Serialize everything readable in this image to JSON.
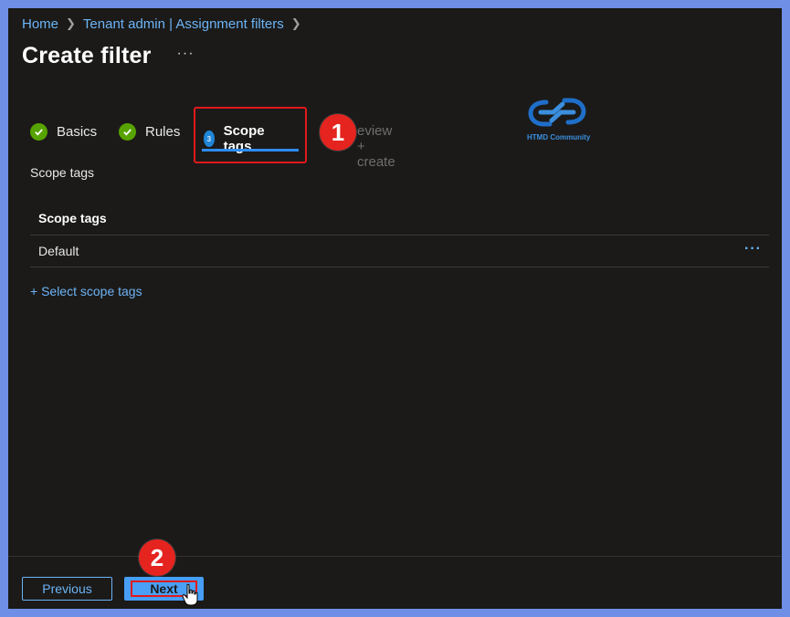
{
  "breadcrumb": {
    "items": [
      "Home",
      "Tenant admin | Assignment filters"
    ]
  },
  "page": {
    "title": "Create filter",
    "more_label": "···"
  },
  "steps": [
    {
      "label": "Basics",
      "state": "complete"
    },
    {
      "label": "Rules",
      "state": "complete"
    },
    {
      "label": "Scope tags",
      "state": "active",
      "number": "3"
    },
    {
      "label": "Review + create",
      "visible_label": "eview + create",
      "state": "upcoming"
    }
  ],
  "annotations": {
    "badge1": "1",
    "badge2": "2"
  },
  "logo": {
    "text": "HTMD Community",
    "icon": "chain-link-logo"
  },
  "scope_tags": {
    "section_label": "Scope tags",
    "column_header": "Scope tags",
    "rows": [
      {
        "name": "Default",
        "more": "···"
      }
    ],
    "select_link": "+ Select scope tags"
  },
  "footer": {
    "previous_label": "Previous",
    "next_label": "Next"
  },
  "colors": {
    "background": "#1b1a19",
    "accent": "#6cb4f5",
    "success": "#57a300",
    "annotation_red": "#e5231f",
    "outer_frame": "#6f8fe6"
  }
}
